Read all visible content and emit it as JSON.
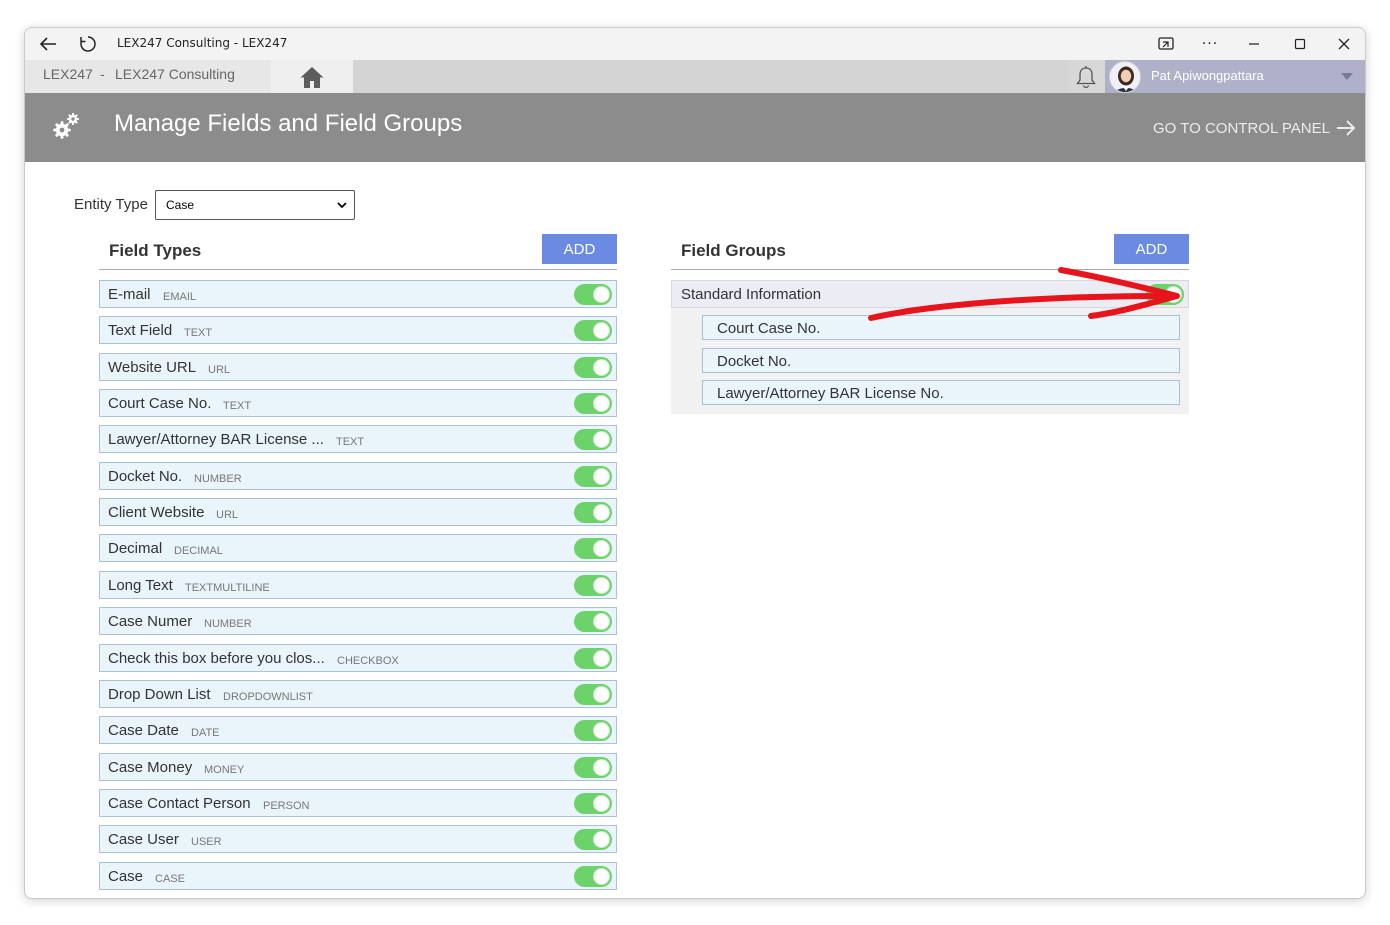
{
  "window": {
    "title": "LEX247 Consulting - LEX247",
    "more_glyph": "···"
  },
  "nav": {
    "org_code": "LEX247",
    "separator": "-",
    "org_name": "LEX247 Consulting",
    "user_name": "Pat Apiwongpattara"
  },
  "header": {
    "title": "Manage Fields and Field Groups",
    "control_panel_label": "GO TO CONTROL PANEL",
    "color": "#8c8c8c"
  },
  "entity": {
    "label": "Entity Type",
    "selected": "Case"
  },
  "field_types": {
    "title": "Field Types",
    "add_label": "ADD",
    "items": [
      {
        "name": "E-mail",
        "type": "EMAIL",
        "enabled": true
      },
      {
        "name": "Text Field",
        "type": "TEXT",
        "enabled": true
      },
      {
        "name": "Website URL",
        "type": "URL",
        "enabled": true
      },
      {
        "name": "Court Case No.",
        "type": "TEXT",
        "enabled": true
      },
      {
        "name": "Lawyer/Attorney BAR License ...",
        "type": "TEXT",
        "enabled": true
      },
      {
        "name": "Docket No.",
        "type": "NUMBER",
        "enabled": true
      },
      {
        "name": "Client Website",
        "type": "URL",
        "enabled": true
      },
      {
        "name": "Decimal",
        "type": "DECIMAL",
        "enabled": true
      },
      {
        "name": "Long Text",
        "type": "TEXTMULTILINE",
        "enabled": true
      },
      {
        "name": "Case Numer",
        "type": "NUMBER",
        "enabled": true
      },
      {
        "name": "Check this box before you clos...",
        "type": "CHECKBOX",
        "enabled": true
      },
      {
        "name": "Drop Down List",
        "type": "DROPDOWNLIST",
        "enabled": true
      },
      {
        "name": "Case Date",
        "type": "DATE",
        "enabled": true
      },
      {
        "name": "Case Money",
        "type": "MONEY",
        "enabled": true
      },
      {
        "name": "Case Contact Person",
        "type": "PERSON",
        "enabled": true
      },
      {
        "name": "Case User",
        "type": "USER",
        "enabled": true
      },
      {
        "name": "Case",
        "type": "CASE",
        "enabled": true
      }
    ]
  },
  "field_groups": {
    "title": "Field Groups",
    "add_label": "ADD",
    "groups": [
      {
        "name": "Standard Information",
        "enabled": true,
        "fields": [
          "Court Case No.",
          "Docket No.",
          "Lawyer/Attorney BAR License No."
        ]
      }
    ]
  },
  "colors": {
    "accent": "#6b8be3",
    "toggle_on": "#6cd26a",
    "annotation": "#e8141c"
  }
}
